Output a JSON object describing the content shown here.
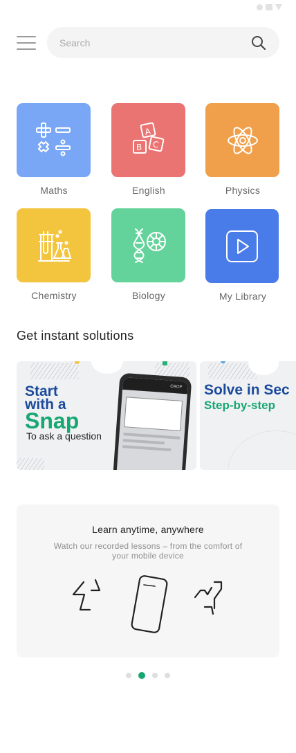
{
  "search": {
    "placeholder": "Search",
    "icon": "search-icon"
  },
  "subjects": [
    {
      "label": "Maths",
      "color": "#79a7f6",
      "icon": "math-operators-icon"
    },
    {
      "label": "English",
      "color": "#ea7472",
      "icon": "abc-blocks-icon"
    },
    {
      "label": "Physics",
      "color": "#f0a04b",
      "icon": "atom-icon"
    },
    {
      "label": "Chemistry",
      "color": "#f3c43d",
      "icon": "lab-flasks-icon"
    },
    {
      "label": "Biology",
      "color": "#63d39b",
      "icon": "dna-cell-icon"
    },
    {
      "label": "My Library",
      "color": "#4a7ce9",
      "icon": "play-icon"
    }
  ],
  "solutions": {
    "title": "Get instant solutions",
    "banners": [
      {
        "line1": "Start",
        "line2": "with a",
        "line3": "Snap",
        "line4": "To ask a question",
        "phone_label": "CROP"
      },
      {
        "line1": "Solve in Sec",
        "line2": "Step-by-step"
      }
    ]
  },
  "feature": {
    "title": "Learn anytime, anywhere",
    "subtitle": "Watch our recorded lessons – from the comfort of your mobile device",
    "icon": "phone-rotate-icon"
  },
  "pager": {
    "count": 4,
    "active": 1
  },
  "colors": {
    "accent": "#17a772",
    "brand_blue": "#1b4a9c"
  }
}
